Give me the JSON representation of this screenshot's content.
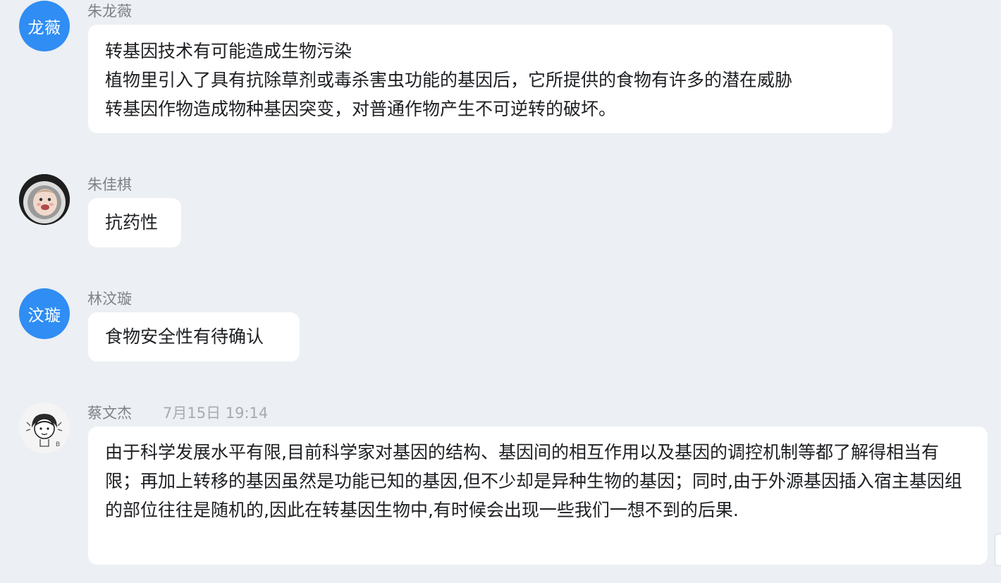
{
  "messages": [
    {
      "sender": "朱龙薇",
      "avatar_text": "龙薇",
      "lines": [
        "转基因技术有可能造成生物污染",
        "植物里引入了具有抗除草剂或毒杀害虫功能的基因后，它所提供的食物有许多的潜在威胁",
        "转基因作物造成物种基因突变，对普通作物产生不可逆转的破坏。"
      ]
    },
    {
      "sender": "朱佳棋",
      "avatar_icon": "baby-astronaut-photo-icon",
      "lines": [
        "抗药性"
      ]
    },
    {
      "sender": "林汶璇",
      "avatar_text": "汶璇",
      "lines": [
        "食物安全性有待确认"
      ]
    },
    {
      "sender": "蔡文杰",
      "time": "7月15日 19:14",
      "avatar_icon": "cartoon-girl-sketch-icon",
      "text": "由于科学发展水平有限,目前科学家对基因的结构、基因间的相互作用以及基因的调控机制等都了解得相当有限；再加上转移的基因虽然是功能已知的基因,但不少却是异种生物的基因；同时,由于外源基因插入宿主基因组的部位往往是随机的,因此在转基因生物中,有时候会出现一些我们一想不到的后果."
    }
  ],
  "colors": {
    "background": "#eceff3",
    "bubble": "#ffffff",
    "avatar_blue": "#2f8df4",
    "sender_name": "#7d8287",
    "timestamp": "#a7abb0"
  }
}
